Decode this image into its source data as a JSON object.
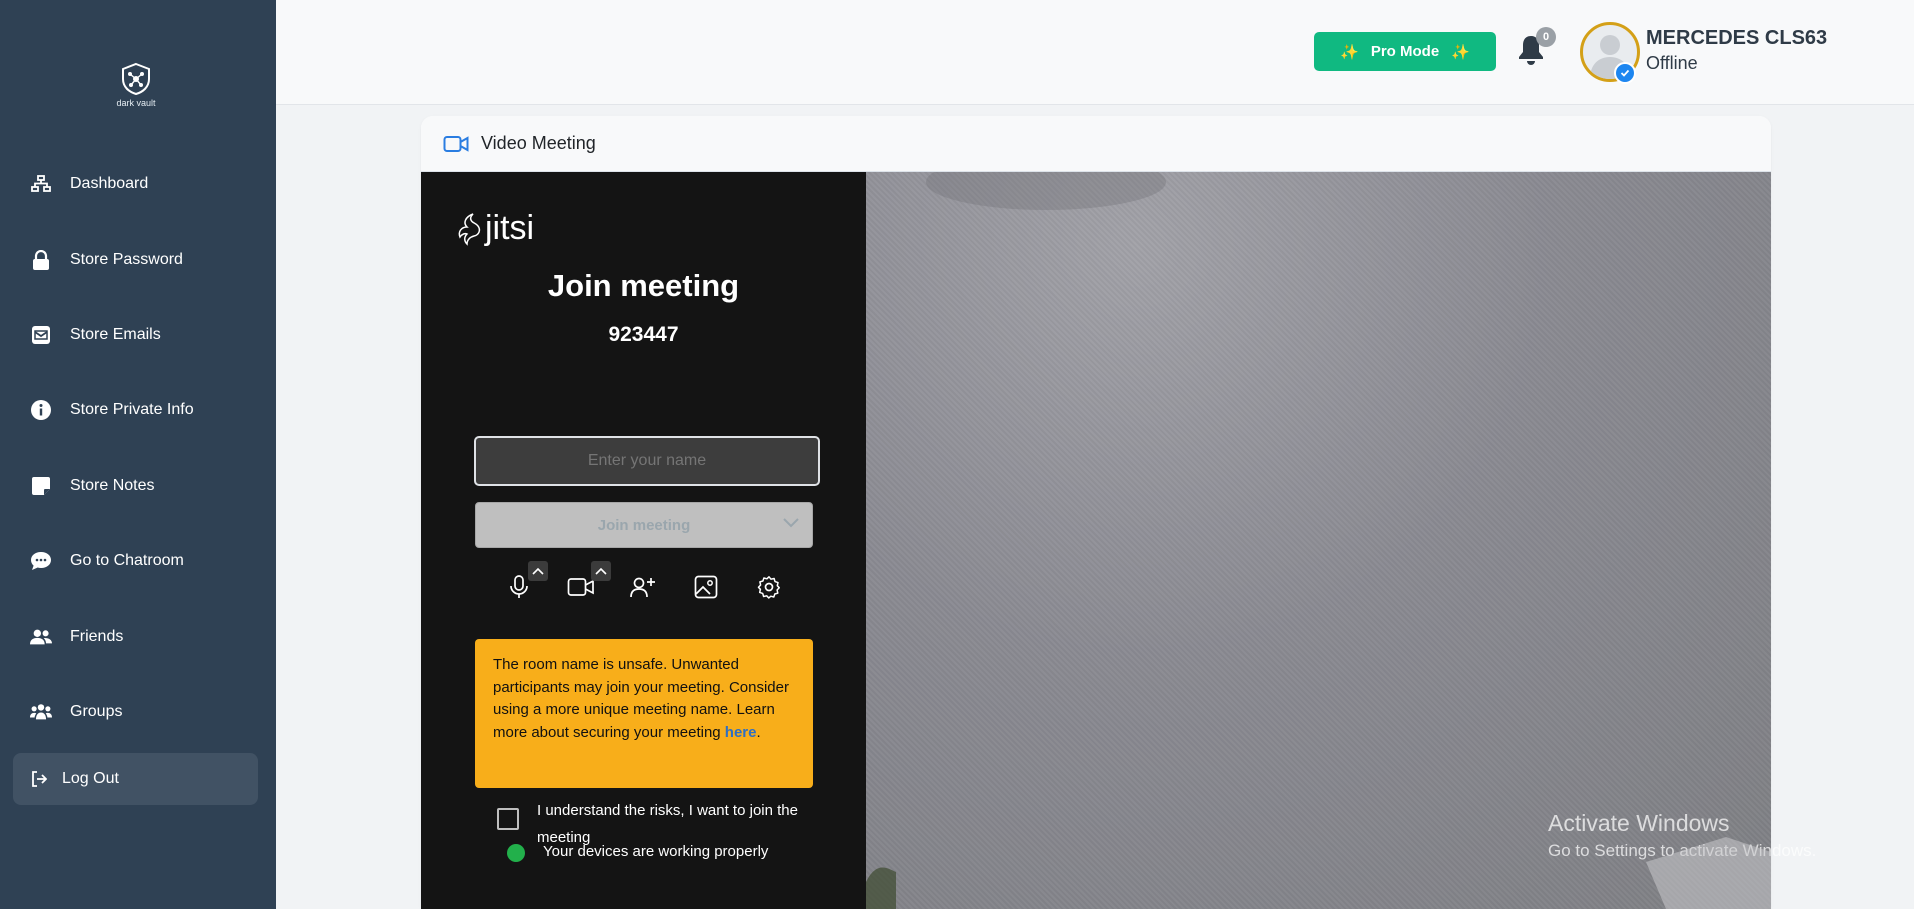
{
  "sidebar": {
    "brand": "dark vault",
    "items": [
      {
        "label": "Dashboard",
        "icon": "sitemap-icon"
      },
      {
        "label": "Store Password",
        "icon": "lock-icon"
      },
      {
        "label": "Store Emails",
        "icon": "envelope-icon"
      },
      {
        "label": "Store Private Info",
        "icon": "info-circle-icon"
      },
      {
        "label": "Store Notes",
        "icon": "note-icon"
      },
      {
        "label": "Go to Chatroom",
        "icon": "chat-bubble-icon"
      },
      {
        "label": "Friends",
        "icon": "user-friends-icon"
      },
      {
        "label": "Groups",
        "icon": "users-group-icon"
      }
    ],
    "logout_label": "Log Out"
  },
  "topbar": {
    "pro_mode_label": "Pro Mode",
    "notifications_count": "0",
    "user_name": "MERCEDES CLS63",
    "user_status": "Offline"
  },
  "card": {
    "title": "Video Meeting"
  },
  "jitsi": {
    "logo_text": "jitsi",
    "join_title": "Join meeting",
    "room_id": "923447",
    "name_placeholder": "Enter your name",
    "join_button_label": "Join meeting",
    "warning_text": "The room name is unsafe. Unwanted participants may join your meeting. Consider using a more unique meeting name. Learn more about securing your meeting ",
    "warning_link": "here",
    "warning_suffix": ".",
    "checkbox_label": "I understand the risks, I want to join the meeting",
    "devices_status": "Your devices are working properly"
  },
  "watermark": {
    "title": "Activate Windows",
    "subtitle": "Go to Settings to activate Windows."
  },
  "colors": {
    "sidebar_bg": "#2f4154",
    "pro_button": "#10b981",
    "warning_bg": "#f8ae1a",
    "status_dot": "#22b04b"
  }
}
